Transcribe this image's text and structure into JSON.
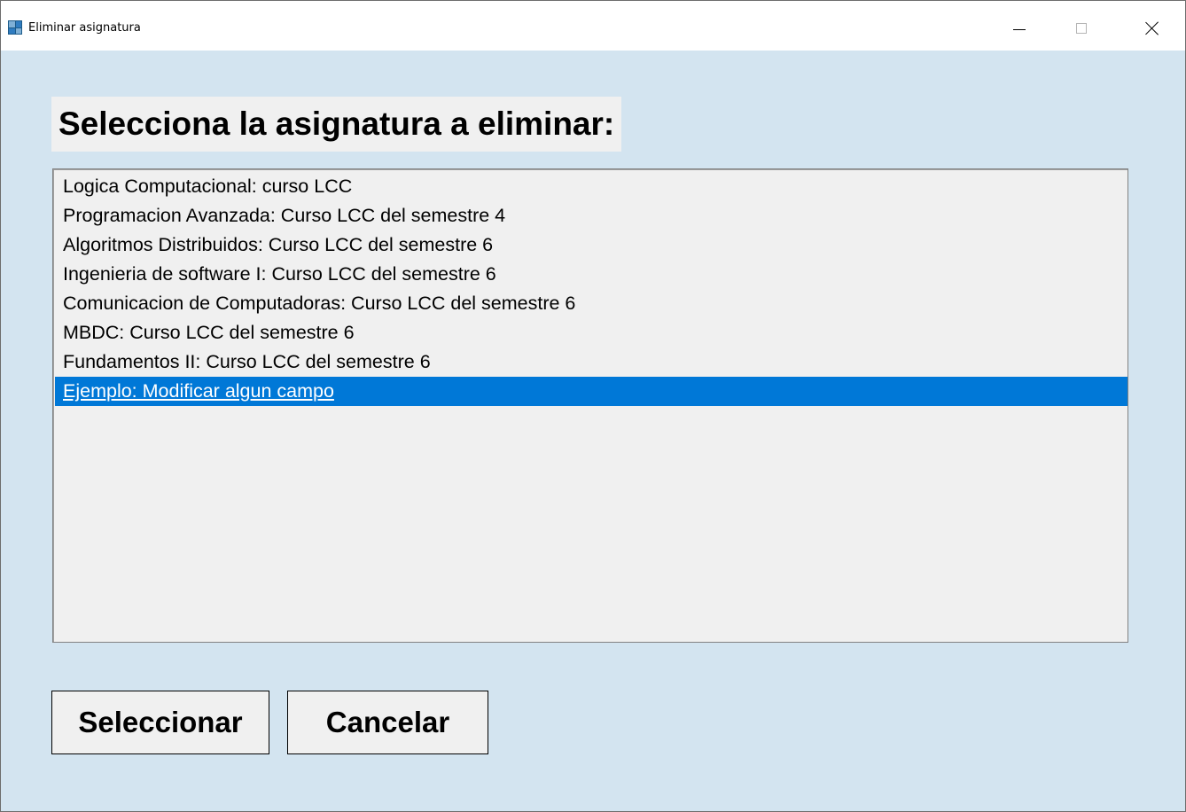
{
  "window": {
    "title": "Eliminar asignatura",
    "controls": {
      "minimize": "minimize",
      "maximize": "maximize",
      "close": "close"
    }
  },
  "heading": "Selecciona la asignatura a eliminar:",
  "list": {
    "items": [
      "Logica Computacional: curso LCC",
      "Programacion Avanzada: Curso LCC del semestre 4",
      "Algoritmos Distribuidos: Curso LCC del semestre 6",
      "Ingenieria de software I: Curso LCC del semestre 6",
      "Comunicacion de Computadoras: Curso LCC del semestre 6",
      "MBDC: Curso LCC del semestre 6",
      "Fundamentos II: Curso LCC del semestre 6",
      "Ejemplo: Modificar algun campo"
    ],
    "selected_index": 7
  },
  "buttons": {
    "select_label": "Seleccionar",
    "cancel_label": "Cancelar"
  },
  "colors": {
    "window_background": "#d3e4f0",
    "control_background": "#f0f0f0",
    "selection": "#0078d7"
  },
  "icons": {
    "app": "app-icon",
    "minimize": "minimize-icon",
    "maximize": "maximize-icon",
    "close": "close-icon"
  }
}
